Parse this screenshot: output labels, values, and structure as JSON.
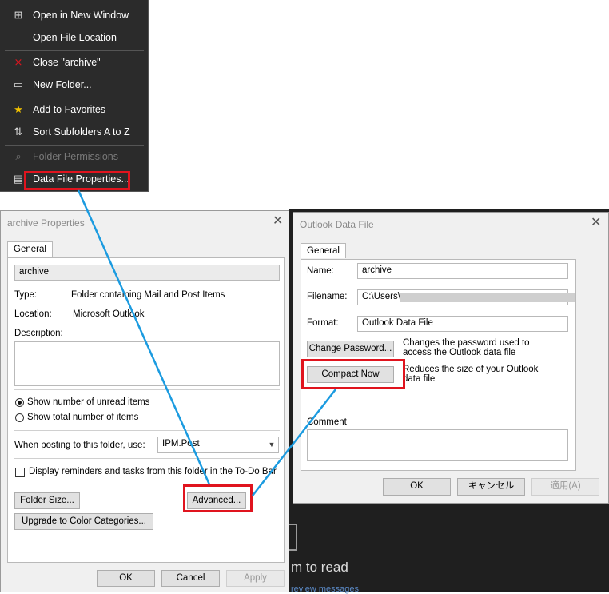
{
  "context_menu": {
    "items": [
      {
        "label": "Open in New Window",
        "icon": "open-window-icon",
        "glyph": "⊞"
      },
      {
        "label": "Open File Location",
        "icon": "",
        "glyph": ""
      },
      {
        "label": "Close \"archive\"",
        "icon": "close-user-icon",
        "glyph": "⨯"
      },
      {
        "label": "New Folder...",
        "icon": "folder-icon",
        "glyph": "▭"
      },
      {
        "label": "Add to Favorites",
        "icon": "star-icon",
        "glyph": "★"
      },
      {
        "label": "Sort Subfolders A to Z",
        "icon": "sort-az-icon",
        "glyph": "⇅"
      },
      {
        "label": "Folder Permissions",
        "icon": "permissions-icon",
        "glyph": "⌕",
        "disabled": true
      },
      {
        "label": "Data File Properties...",
        "icon": "data-file-icon",
        "glyph": "▤"
      }
    ]
  },
  "archive_props": {
    "title": "archive Properties",
    "tab": "General",
    "name_value": "archive",
    "type_label": "Type:",
    "type_value": "Folder containing Mail and Post Items",
    "location_label": "Location:",
    "location_value": "Microsoft Outlook",
    "description_label": "Description:",
    "radio_unread": "Show number of unread items",
    "radio_total": "Show total number of items",
    "posting_label": "When posting to this folder, use:",
    "posting_value": "IPM.Post",
    "reminders_label": "Display reminders and tasks from this folder in the To-Do Bar",
    "folder_size_btn": "Folder Size...",
    "advanced_btn": "Advanced...",
    "upgrade_btn": "Upgrade to Color Categories...",
    "ok_btn": "OK",
    "cancel_btn": "Cancel",
    "apply_btn": "Apply"
  },
  "data_file": {
    "title": "Outlook Data File",
    "tab": "General",
    "name_label": "Name:",
    "name_value": "archive",
    "filename_label": "Filename:",
    "filename_value": "C:\\Users\\",
    "format_label": "Format:",
    "format_value": "Outlook Data File",
    "change_pw_btn": "Change Password...",
    "change_pw_desc": "Changes the password used to access the Outlook data file",
    "compact_btn": "Compact Now",
    "compact_desc": "Reduces the size of your Outlook data file",
    "comment_label": "Comment",
    "ok_btn": "OK",
    "cancel_btn": "キャンセル",
    "apply_btn": "適用(A)"
  },
  "background": {
    "text": "m to read",
    "sub": "review messages"
  },
  "colors": {
    "highlight": "#e0141e",
    "connector": "#1b9be0"
  }
}
